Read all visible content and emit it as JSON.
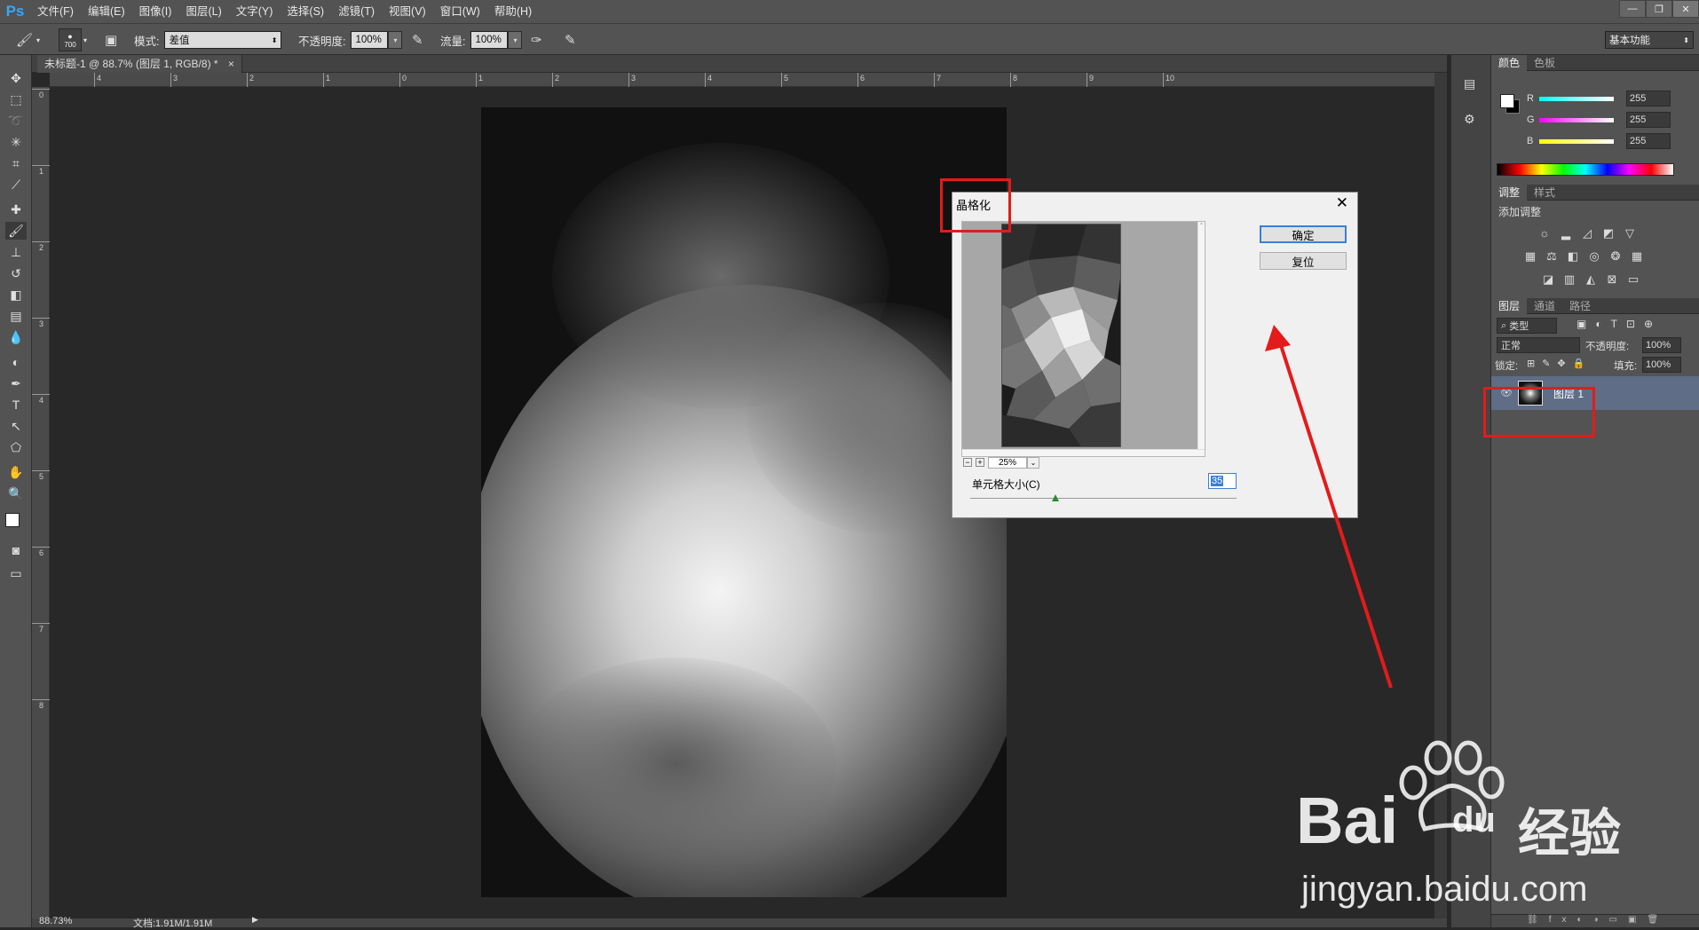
{
  "app": {
    "logo": "Ps"
  },
  "menu": [
    "文件(F)",
    "编辑(E)",
    "图像(I)",
    "图层(L)",
    "文字(Y)",
    "选择(S)",
    "滤镜(T)",
    "视图(V)",
    "窗口(W)",
    "帮助(H)"
  ],
  "options": {
    "brush_size": "700",
    "mode_label": "模式:",
    "mode_value": "差值",
    "opacity_label": "不透明度:",
    "opacity_value": "100%",
    "flow_label": "流量:",
    "flow_value": "100%",
    "workspace": "基本功能"
  },
  "document": {
    "tab_title": "未标题-1 @ 88.7% (图层 1, RGB/8) *",
    "tab_close": "×",
    "zoom": "88.73%",
    "doc_info": "文档:1.91M/1.91M"
  },
  "rulers": {
    "h": [
      "4",
      "3",
      "2",
      "1",
      "0",
      "1",
      "2",
      "3",
      "4",
      "5",
      "6",
      "7",
      "8",
      "9",
      "10"
    ],
    "v": [
      "0",
      "1",
      "2",
      "3",
      "4",
      "5",
      "6",
      "7",
      "8"
    ]
  },
  "color_panel": {
    "tabs": [
      "颜色",
      "色板"
    ],
    "channels": [
      {
        "label": "R",
        "value": "255",
        "color": "#00ffff"
      },
      {
        "label": "G",
        "value": "255",
        "color": "#ff00ff"
      },
      {
        "label": "B",
        "value": "255",
        "color": "#ffff00"
      }
    ]
  },
  "adjustments_panel": {
    "tabs": [
      "调整",
      "样式"
    ],
    "title": "添加调整"
  },
  "layers_panel": {
    "tabs": [
      "图层",
      "通道",
      "路径"
    ],
    "filter_kind": "类型",
    "blend_mode": "正常",
    "opacity_label": "不透明度:",
    "opacity_value": "100%",
    "lock_label": "锁定:",
    "fill_label": "填充:",
    "fill_value": "100%",
    "layers": [
      {
        "name": "图层 1"
      }
    ]
  },
  "dialog": {
    "title": "晶格化",
    "ok": "确定",
    "reset": "复位",
    "preview_zoom": "25%",
    "cell_size_label": "单元格大小(C)",
    "cell_size_value": "35"
  },
  "watermark": {
    "brand": "Bai",
    "brand2": "du",
    "brand_cn": "经验",
    "url": "jingyan.baidu.com"
  },
  "colors": {
    "accent_red": "#e31b1b",
    "selection_blue": "#3c7fd3",
    "ps_blue": "#31a8ff"
  }
}
